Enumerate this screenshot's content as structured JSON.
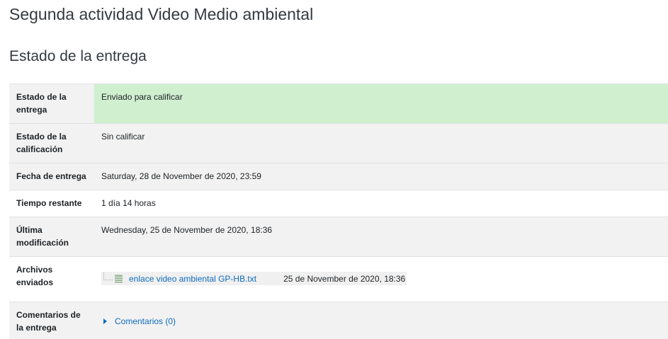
{
  "page": {
    "title": "Segunda actividad Video Medio ambiental",
    "section_title": "Estado de la entrega"
  },
  "status_table": {
    "rows": [
      {
        "label": "Estado de la entrega",
        "value": "Enviado para calificar"
      },
      {
        "label": "Estado de la calificación",
        "value": "Sin calificar"
      },
      {
        "label": "Fecha de entrega",
        "value": "Saturday, 28 de November de 2020, 23:59"
      },
      {
        "label": "Tiempo restante",
        "value": "1 día 14 horas"
      },
      {
        "label": "Última modificación",
        "value": "Wednesday, 25 de November de 2020, 18:36"
      },
      {
        "label": "Archivos enviados",
        "value": ""
      },
      {
        "label": "Comentarios de la entrega",
        "value": ""
      }
    ],
    "submitted_files": [
      {
        "name": "enlace video ambiental GP-HB.txt",
        "date": "25 de November de 2020, 18:36",
        "icon": "text-file-icon"
      }
    ],
    "comments_link": "Comentarios (0)"
  },
  "colors": {
    "submitted_bg": "#cfefcf",
    "row_grey": "#f2f2f2",
    "link": "#0f6cbf"
  }
}
